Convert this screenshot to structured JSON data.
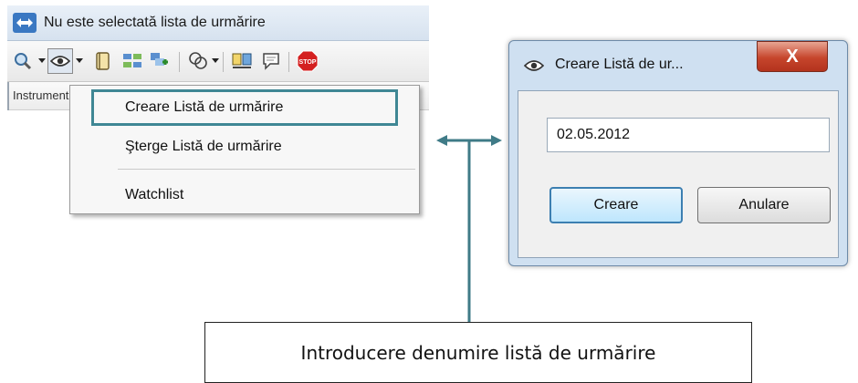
{
  "main_window": {
    "title": "Nu este selectată lista de urmărire",
    "column_header": "Instrument",
    "toolbar_icons": [
      "zoom-icon",
      "eye-icon",
      "book-icon",
      "export-icon",
      "add-icon",
      "group-icon",
      "compare-icon",
      "note-icon",
      "stop-icon"
    ]
  },
  "dropdown_menu": {
    "items": [
      {
        "label": "Creare Listă de urmărire",
        "highlighted": true
      },
      {
        "label": "Şterge Listă de urmărire",
        "highlighted": false
      },
      {
        "label": "Watchlist",
        "highlighted": false
      }
    ]
  },
  "dialog": {
    "title": "Creare Listă de ur...",
    "close_label": "X",
    "name_value": "02.05.2012",
    "create_label": "Creare",
    "cancel_label": "Anulare"
  },
  "annotation": {
    "callout_text": "Introducere denumire listă de urmărire",
    "colors": {
      "highlight": "#3f8794",
      "arrow": "#3f7b87"
    }
  }
}
